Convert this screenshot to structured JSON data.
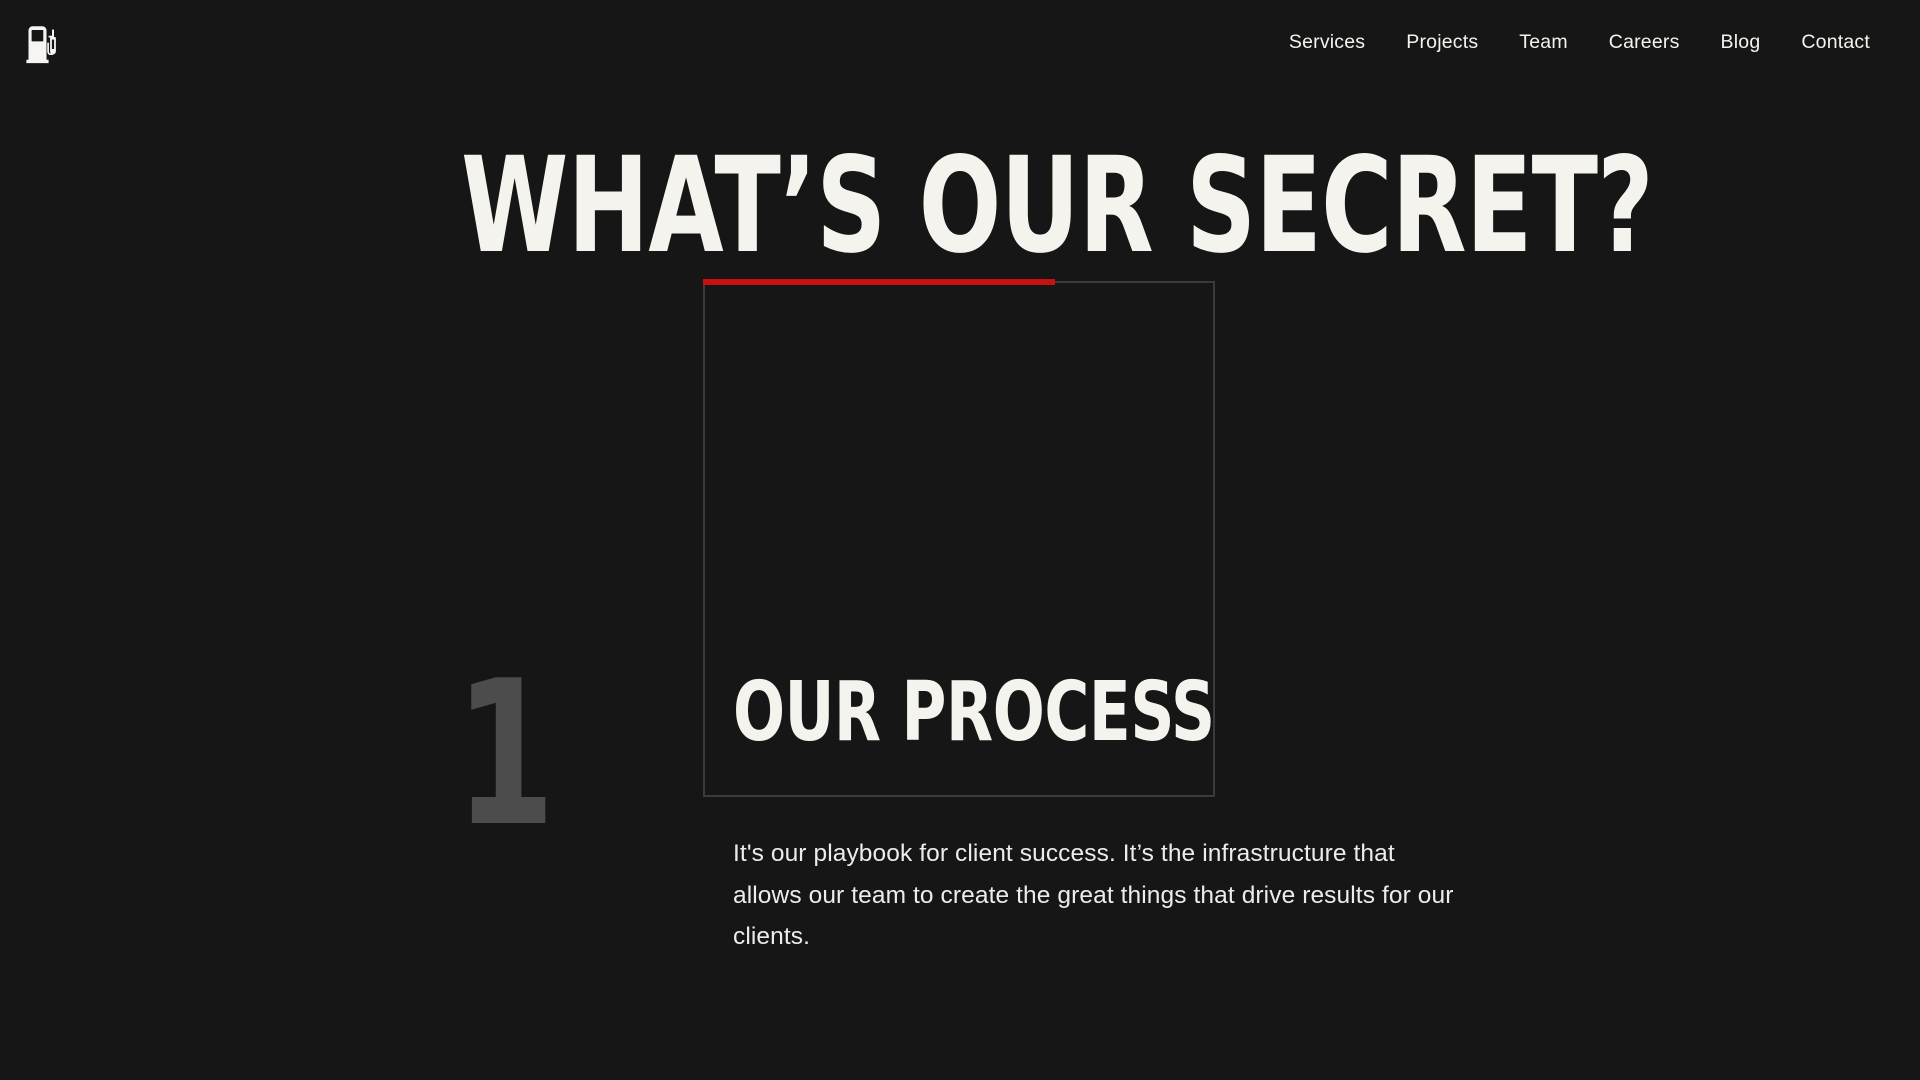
{
  "theme": {
    "background": "#161616",
    "text": "#f4f3ee",
    "accent_red": "#c71111",
    "frame_border": "#3b3b3b",
    "step_number_color": "#4c4c4c",
    "body_text": "#ececec"
  },
  "header": {
    "logo": {
      "icon": "gas-pump-icon",
      "label": "Gas pump logo"
    },
    "nav": [
      {
        "label": "Services"
      },
      {
        "label": "Projects"
      },
      {
        "label": "Team"
      },
      {
        "label": "Careers"
      },
      {
        "label": "Blog"
      },
      {
        "label": "Contact"
      }
    ]
  },
  "hero": {
    "title": "WHAT’S OUR SECRET?"
  },
  "steps": [
    {
      "number": "1",
      "title": "OUR PROCESS",
      "body": "It's our playbook for client success. It’s the infrastructure that allows our team to create the great things that drive results for our clients."
    }
  ]
}
